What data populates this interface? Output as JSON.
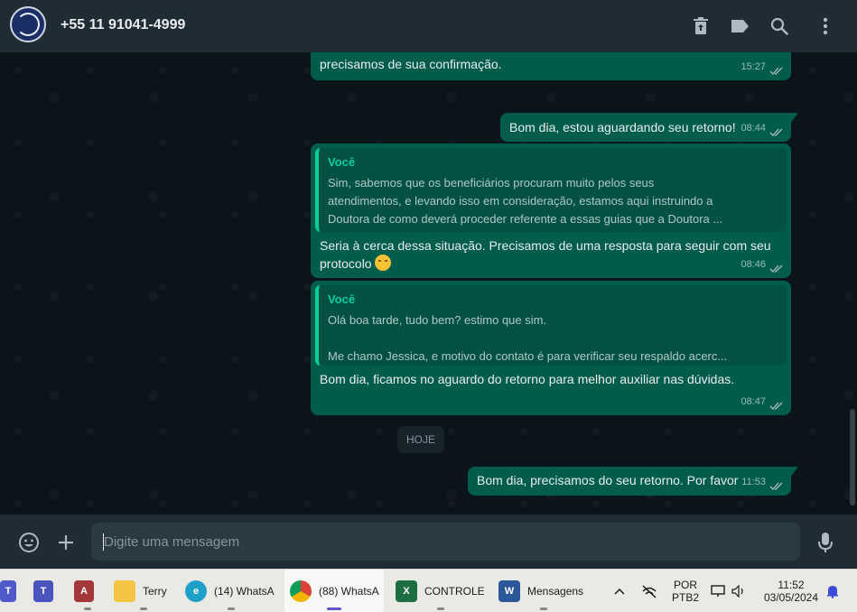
{
  "header": {
    "contact_name": "+55 11 91041-4999",
    "icons": [
      "delete-icon",
      "label-icon",
      "search-icon",
      "menu-icon"
    ]
  },
  "messages": [
    {
      "text": "precisamos de sua confirmação.",
      "time": "15:27"
    },
    {
      "text": "Bom dia, estou aguardando seu retorno!",
      "time": "08:44"
    },
    {
      "quote_author": "Você",
      "quote_lines": [
        "Sim, sabemos que os beneficiários procuram muito pelos seus",
        "atendimentos, e levando isso em consideração, estamos aqui instruindo a",
        "Doutora de como deverá proceder referente a essas guias que a Doutora ..."
      ],
      "text_line1": "Seria à cerca dessa situação. Precisamos de uma resposta para seguir com seu",
      "text_line2": "protocolo",
      "time": "08:46"
    },
    {
      "quote_author": "Você",
      "quote_lines": [
        "Olá boa tarde, tudo bem? estimo que sim.",
        "",
        "Me chamo Jessica, e motivo do contato é para verificar seu respaldo acerc..."
      ],
      "text": "Bom dia, ficamos no aguardo do retorno para melhor auxiliar nas dúvidas.",
      "time": "08:47"
    },
    {
      "text": "Bom dia, precisamos do seu retorno. Por favor",
      "time": "11:53"
    }
  ],
  "date_divider": "HOJE",
  "composer": {
    "placeholder": "Digite uma mensagem"
  },
  "taskbar": {
    "apps": [
      {
        "label": "Terry"
      },
      {
        "label": "(14) WhatsA"
      },
      {
        "label": "(88) WhatsA"
      },
      {
        "label": "CONTROLE"
      },
      {
        "label": "Mensagens"
      }
    ],
    "language_line1": "POR",
    "language_line2": "PTB2",
    "time": "11:52",
    "date": "03/05/2024"
  },
  "colors": {
    "outgoing_bubble": "#005c4b",
    "accent": "#06cf9c",
    "header": "#202c33",
    "chat_bg": "#0b141a"
  }
}
